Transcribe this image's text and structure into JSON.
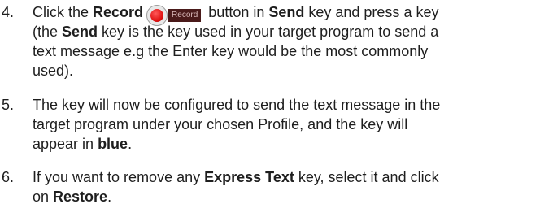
{
  "steps": [
    {
      "number": "4.",
      "line1": {
        "t1": "Click the ",
        "b1": "Record",
        "icon_label": "Record",
        "t2": " button in ",
        "b2": "Send",
        "t3": " key and press a key"
      },
      "line2": {
        "t1": "(the ",
        "b1": "Send",
        "t2": " key is the key used in your target program to send a"
      },
      "line3": "text message e.g the Enter key would be the most commonly",
      "line4": "used)."
    },
    {
      "number": "5.",
      "line1": "The key will now be configured to send the text message in the",
      "line2": "target program under your chosen Profile, and the key will",
      "line3": {
        "t1": "appear in ",
        "b1": "blue",
        "t2": "."
      }
    },
    {
      "number": "6.",
      "line1": {
        "t1": "If you want to remove any ",
        "b1": "Express Text",
        "t2": " key, select it and click"
      },
      "line2": {
        "t1": "on ",
        "b1": "Restore",
        "t2": "."
      }
    }
  ],
  "colors": {
    "text": "#1e1e1e",
    "record_red": "#e11515"
  },
  "icons": {
    "record": "record-icon"
  }
}
